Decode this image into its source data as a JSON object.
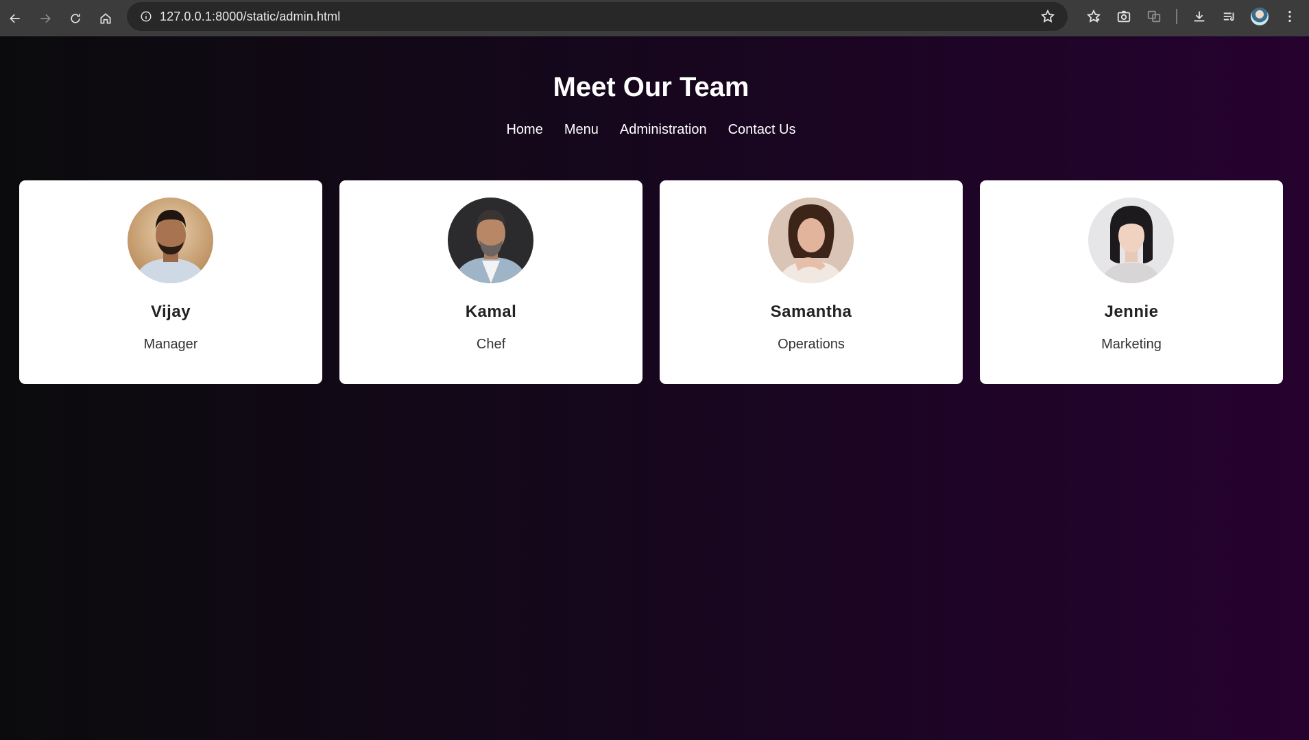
{
  "browser": {
    "url": "127.0.0.1:8000/static/admin.html"
  },
  "page": {
    "title": "Meet Our Team",
    "nav": [
      "Home",
      "Menu",
      "Administration",
      "Contact Us"
    ]
  },
  "team": [
    {
      "name": "Vijay",
      "role": "Manager"
    },
    {
      "name": "Kamal",
      "role": "Chef"
    },
    {
      "name": "Samantha",
      "role": "Operations"
    },
    {
      "name": "Jennie",
      "role": "Marketing"
    }
  ],
  "colors": {
    "background_start": "#0b0b0d",
    "background_end": "#26022f",
    "card": "#ffffff",
    "chrome": "#3c3c3c"
  }
}
